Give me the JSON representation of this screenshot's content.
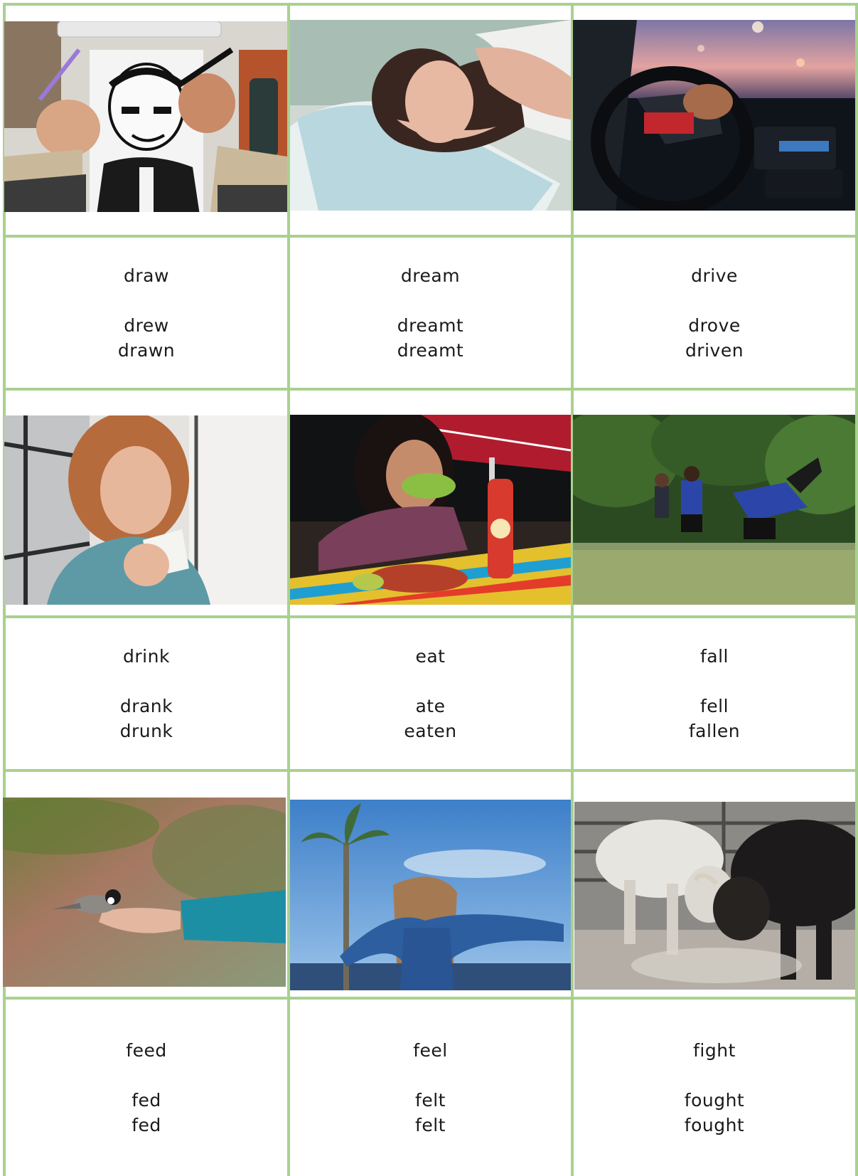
{
  "colors": {
    "grid": "#a9d18e",
    "text": "#1a1a1a"
  },
  "rows": [
    {
      "cards": [
        {
          "photo_icon": "drawing-photo-icon",
          "base": "draw",
          "past": "drew",
          "participle": "drawn"
        },
        {
          "photo_icon": "sleeping-photo-icon",
          "base": "dream",
          "past": "dreamt",
          "participle": "dreamt"
        },
        {
          "photo_icon": "driving-photo-icon",
          "base": "drive",
          "past": "drove",
          "participle": "driven"
        }
      ]
    },
    {
      "cards": [
        {
          "photo_icon": "drinking-photo-icon",
          "base": "drink",
          "past": "drank",
          "participle": "drunk"
        },
        {
          "photo_icon": "eating-photo-icon",
          "base": "eat",
          "past": "ate",
          "participle": "eaten"
        },
        {
          "photo_icon": "rugby-photo-icon",
          "base": "fall",
          "past": "fell",
          "participle": "fallen"
        }
      ]
    },
    {
      "cards": [
        {
          "photo_icon": "bird-feeding-photo-icon",
          "base": "feed",
          "past": "fed",
          "participle": "fed"
        },
        {
          "photo_icon": "palm-beach-photo-icon",
          "base": "feel",
          "past": "felt",
          "participle": "felt"
        },
        {
          "photo_icon": "bulls-fighting-photo-icon",
          "base": "fight",
          "past": "fought",
          "participle": "fought"
        }
      ]
    }
  ]
}
